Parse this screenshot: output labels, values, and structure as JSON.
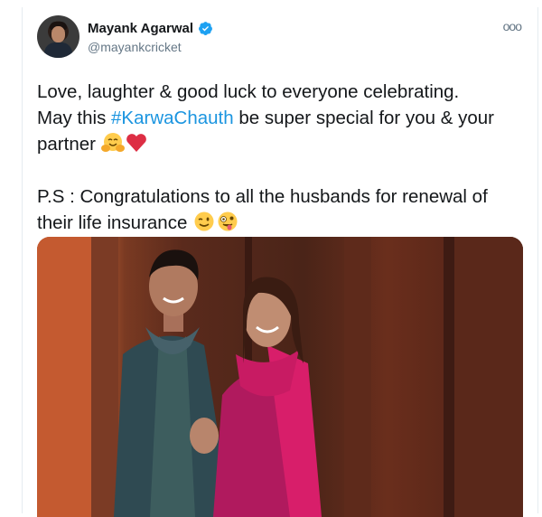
{
  "tweet": {
    "author": {
      "display_name": "Mayank Agarwal",
      "handle": "@mayankcricket",
      "verified": true
    },
    "more_icon": "ooo",
    "text": {
      "line1": "Love, laughter & good luck to everyone celebrating.",
      "line2_before": "May this ",
      "hashtag": "#KarwaChauth",
      "line2_after": " be super special for you & your",
      "line3": "partner ",
      "line4": "P.S : Congratulations to all the husbands for renewal of",
      "line5": "their life insurance "
    },
    "emojis": [
      "hugging-face",
      "red-heart",
      "winking-face",
      "zany-face"
    ],
    "media": {
      "type": "photo"
    }
  },
  "colors": {
    "hashtag": "#1b95e0",
    "verified": "#1da1f2",
    "handle": "#657786"
  }
}
